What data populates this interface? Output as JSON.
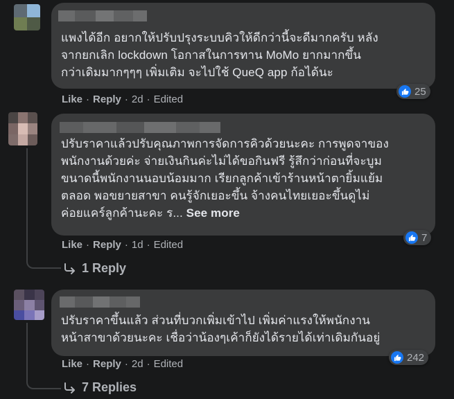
{
  "comments": [
    {
      "text": "แพงได้อีก อยากให้ปรับปรุงระบบคิวให้ดีกว่านี้จะดีมากครับ หลัง\nจากยกเลิก lockdown โอกาสในการทาน MoMo ยากมากขึ้น\nกว่าเดิมมากๆๆๆ เพิ่มเติม จะไปใช้ QueQ app ก้อได้นะ",
      "like_label": "Like",
      "reply_label": "Reply",
      "time": "2d",
      "edited": "Edited",
      "reaction_count": "25"
    },
    {
      "text": "ปรับราคาแล้วปรับคุณภาพการจัดการคิวด้วยนะคะ การพูดจาของ\nพนักงานด้วยค่ะ จ่ายเงินกินค่ะไม่ได้ขอกินฟรี รู้สึกว่าก่อนที่จะบูม\nขนาดนี้พนักงานนอบน้อมมาก เรียกลูกค้าเข้าร้านหน้าตายิ้มแย้ม\nตลอด พอขยายสาขา คนรู้จักเยอะขึ้น จ้างคนไทยเยอะขึ้นดูไม่\nค่อยแคร์ลูกค้านะคะ ร...",
      "see_more": "See more",
      "like_label": "Like",
      "reply_label": "Reply",
      "time": "1d",
      "edited": "Edited",
      "reaction_count": "7",
      "replies_label": "1 Reply"
    },
    {
      "text": "ปรับราคาขึ้นแล้ว ส่วนที่บวกเพิ่มเข้าไป เพิ่มค่าแรงให้พนักงาน\nหน้าสาขาด้วยนะคะ เชื่อว่าน้องๆเค้าก็ยังได้รายได้เท่าเดิมกันอยู่",
      "like_label": "Like",
      "reply_label": "Reply",
      "time": "2d",
      "edited": "Edited",
      "reaction_count": "242",
      "replies_label": "7 Replies"
    }
  ],
  "colors": {
    "background": "#18191a",
    "bubble": "#3a3b3c",
    "text": "#e4e6eb",
    "secondary_text": "#b0b3b8",
    "like_blue": "#1877f2"
  },
  "icons": {
    "reaction": "thumbs-up-icon",
    "replies": "reply-arrow-icon"
  }
}
